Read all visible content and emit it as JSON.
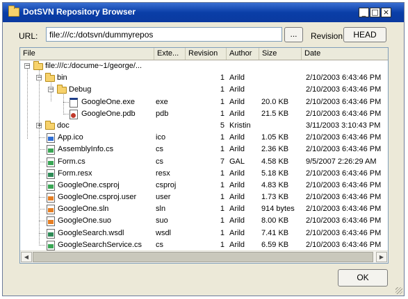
{
  "window": {
    "title": "DotSVN Repository Browser"
  },
  "titlebar": {
    "minimize": "_",
    "maximize": "□",
    "close": "×"
  },
  "url": {
    "label": "URL:",
    "value": "file:///c:/dotsvn/dummyrepos",
    "browse_label": "..."
  },
  "revision": {
    "label": "Revision:",
    "button_label": "HEAD"
  },
  "columns": [
    "File",
    "Exte...",
    "Revision",
    "Author",
    "Size",
    "Date"
  ],
  "rows": [
    {
      "name": "file:///c:/docume~1/george/...",
      "ext": "",
      "rev": "",
      "author": "",
      "size": "",
      "date": ""
    },
    {
      "name": "bin",
      "ext": "",
      "rev": "1",
      "author": "Arild",
      "size": "",
      "date": "2/10/2003 6:43:46 PM"
    },
    {
      "name": "Debug",
      "ext": "",
      "rev": "1",
      "author": "Arild",
      "size": "",
      "date": "2/10/2003 6:43:46 PM"
    },
    {
      "name": "GoogleOne.exe",
      "ext": "exe",
      "rev": "1",
      "author": "Arild",
      "size": "20.0 KB",
      "date": "2/10/2003 6:43:46 PM"
    },
    {
      "name": "GoogleOne.pdb",
      "ext": "pdb",
      "rev": "1",
      "author": "Arild",
      "size": "21.5 KB",
      "date": "2/10/2003 6:43:46 PM"
    },
    {
      "name": "doc",
      "ext": "",
      "rev": "5",
      "author": "Kristin",
      "size": "",
      "date": "3/11/2003 3:10:43 PM"
    },
    {
      "name": "App.ico",
      "ext": "ico",
      "rev": "1",
      "author": "Arild",
      "size": "1.05 KB",
      "date": "2/10/2003 6:43:46 PM"
    },
    {
      "name": "AssemblyInfo.cs",
      "ext": "cs",
      "rev": "1",
      "author": "Arild",
      "size": "2.36 KB",
      "date": "2/10/2003 6:43:46 PM"
    },
    {
      "name": "Form.cs",
      "ext": "cs",
      "rev": "7",
      "author": "GAL",
      "size": "4.58 KB",
      "date": "9/5/2007 2:26:29 AM"
    },
    {
      "name": "Form.resx",
      "ext": "resx",
      "rev": "1",
      "author": "Arild",
      "size": "5.18 KB",
      "date": "2/10/2003 6:43:46 PM"
    },
    {
      "name": "GoogleOne.csproj",
      "ext": "csproj",
      "rev": "1",
      "author": "Arild",
      "size": "4.83 KB",
      "date": "2/10/2003 6:43:46 PM"
    },
    {
      "name": "GoogleOne.csproj.user",
      "ext": "user",
      "rev": "1",
      "author": "Arild",
      "size": "1.73 KB",
      "date": "2/10/2003 6:43:46 PM"
    },
    {
      "name": "GoogleOne.sln",
      "ext": "sln",
      "rev": "1",
      "author": "Arild",
      "size": "914 bytes",
      "date": "2/10/2003 6:43:46 PM"
    },
    {
      "name": "GoogleOne.suo",
      "ext": "suo",
      "rev": "1",
      "author": "Arild",
      "size": "8.00 KB",
      "date": "2/10/2003 6:43:46 PM"
    },
    {
      "name": "GoogleSearch.wsdl",
      "ext": "wsdl",
      "rev": "1",
      "author": "Arild",
      "size": "7.41 KB",
      "date": "2/10/2003 6:43:46 PM"
    },
    {
      "name": "GoogleSearchService.cs",
      "ext": "cs",
      "rev": "1",
      "author": "Arild",
      "size": "6.59 KB",
      "date": "2/10/2003 6:43:46 PM"
    }
  ],
  "tree": {
    "expander_collapse": "−",
    "expander_expand": "+"
  },
  "scrollbar": {
    "left_arrow": "◀",
    "right_arrow": "▶"
  },
  "footer": {
    "ok_label": "OK"
  },
  "colors": {
    "title_bar": "#0a3ea7",
    "window_bg": "#ece9d8",
    "folder": "#f7d26c"
  }
}
